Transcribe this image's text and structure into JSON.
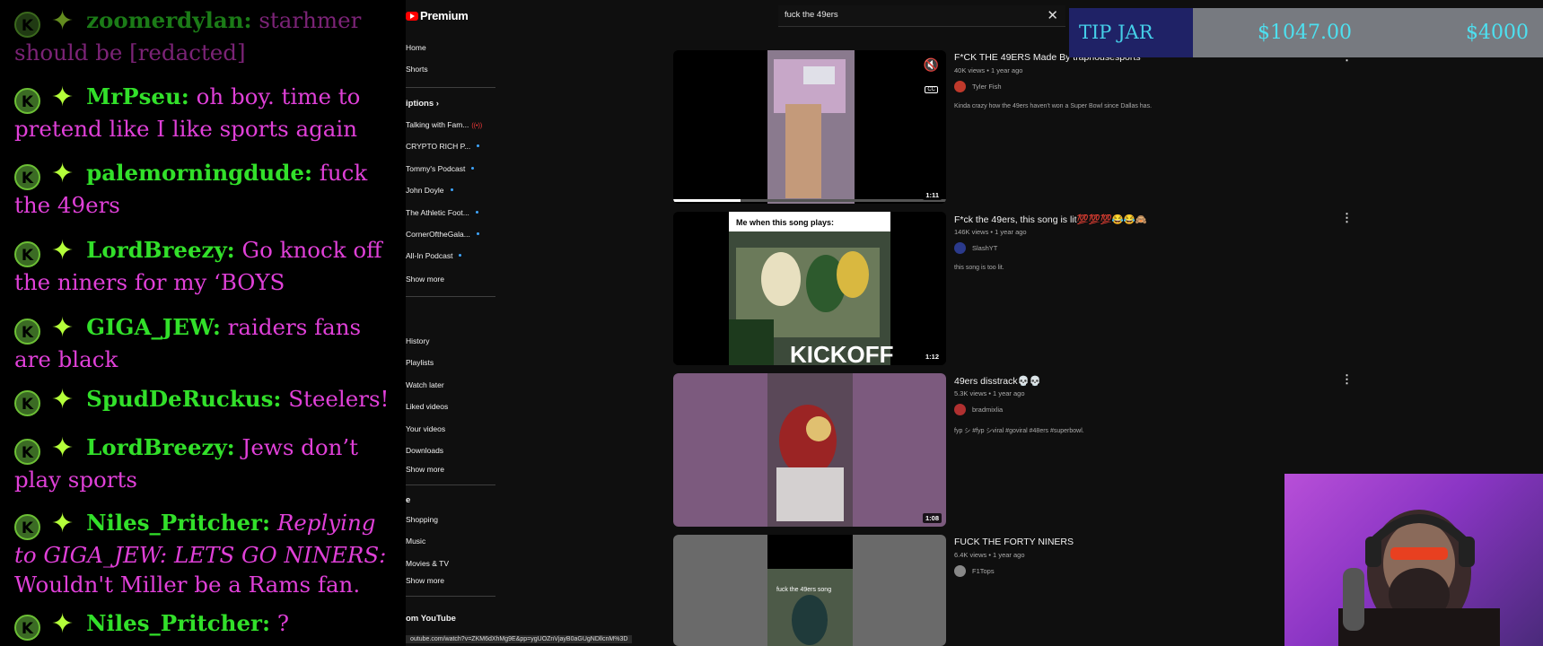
{
  "chat": {
    "messages": [
      {
        "user": "zoomerdylan:",
        "text": "starhmer should be [redacted]"
      },
      {
        "user": "MrPseu:",
        "text": "oh boy. time to pretend like I like sports again"
      },
      {
        "user": "palemorningdude:",
        "text": "fuck the 49ers"
      },
      {
        "user": "LordBreezy:",
        "text": "Go knock off the niners for my ‘BOYS"
      },
      {
        "user": "GIGA_JEW:",
        "text": "raiders fans are black"
      },
      {
        "user": "SpudDeRuckus:",
        "text": "Steelers!"
      },
      {
        "user": "LordBreezy:",
        "text": "Jews don’t play sports"
      },
      {
        "user": "Niles_Pritcher:",
        "reply": "Replying to GIGA_JEW: LETS GO NINERS:",
        "text": "Wouldn't Miller be a Rams fan."
      },
      {
        "user": "Niles_Pritcher:",
        "text": "?"
      }
    ],
    "badge": "K",
    "star_icon": "sparkle-icon"
  },
  "youtube": {
    "logo": "Premium",
    "search_value": "fuck the 49ers",
    "sidebar": {
      "home": "Home",
      "shorts": "Shorts",
      "subscriptions": "iptions",
      "subs": [
        {
          "label": "Talking with Fam...",
          "live": true
        },
        {
          "label": "CRYPTO RICH P...",
          "dot": true
        },
        {
          "label": "Tommy's Podcast",
          "dot": true
        },
        {
          "label": "John Doyle",
          "dot": true
        },
        {
          "label": "The Athletic Foot...",
          "dot": true
        },
        {
          "label": "CornerOftheGala...",
          "dot": true
        },
        {
          "label": "All-In Podcast",
          "dot": true
        }
      ],
      "show_more_1": "Show more",
      "you": [
        "History",
        "Playlists",
        "Watch later",
        "Liked videos",
        "Your videos",
        "Downloads"
      ],
      "show_more_2": "Show more",
      "explore_letter": "e",
      "explore": [
        "Shopping",
        "Music",
        "Movies & TV"
      ],
      "show_more_3": "Show more",
      "more_from": "om YouTube"
    },
    "results": [
      {
        "title": "F*CK THE 49ERS Made By traphousesports",
        "meta": "40K views • 1 year ago",
        "channel": "Tyler Fish",
        "desc": "Kinda crazy how the 49ers haven't won a Super Bowl since Dallas has.",
        "duration": "1:11",
        "avatar_color": "#c0392b"
      },
      {
        "title": "F*ck the 49ers, this song is lit💯💯💯😂😂🙈",
        "meta": "146K views • 1 year ago",
        "channel": "SlashYT",
        "desc": "this song is too lit.",
        "duration": "1:12",
        "thumb_caption": "Me when this song plays:",
        "avatar_color": "#2b3a8c"
      },
      {
        "title": "49ers disstrack💀💀",
        "meta": "5.3K views • 1 year ago",
        "channel": "bradmixlia",
        "desc": "fyp シ #fyp シviral #goviral #48ers #superbowl.",
        "duration": "1:08",
        "avatar_color": "#b03030"
      },
      {
        "title": "FUCK THE FORTY NINERS",
        "meta": "6.4K views • 1 year ago",
        "channel": "F1Tops",
        "desc": "",
        "duration": "",
        "thumb_caption": "fuck the 49ers song",
        "avatar_color": "#888888"
      }
    ],
    "status_url": "outube.com/watch?v=ZKM6dXhMg9E&pp=ygUOZnVjayB0aGUgNDllcnM%3D"
  },
  "tipjar": {
    "label": "TIP JAR",
    "current": "$1047.00",
    "goal": "$4000",
    "progress": 0.26
  },
  "colors": {
    "username": "#32e02a",
    "message": "#e040d8",
    "tip_text": "#4de0f0",
    "tip_label_bg": "#1f2266"
  }
}
